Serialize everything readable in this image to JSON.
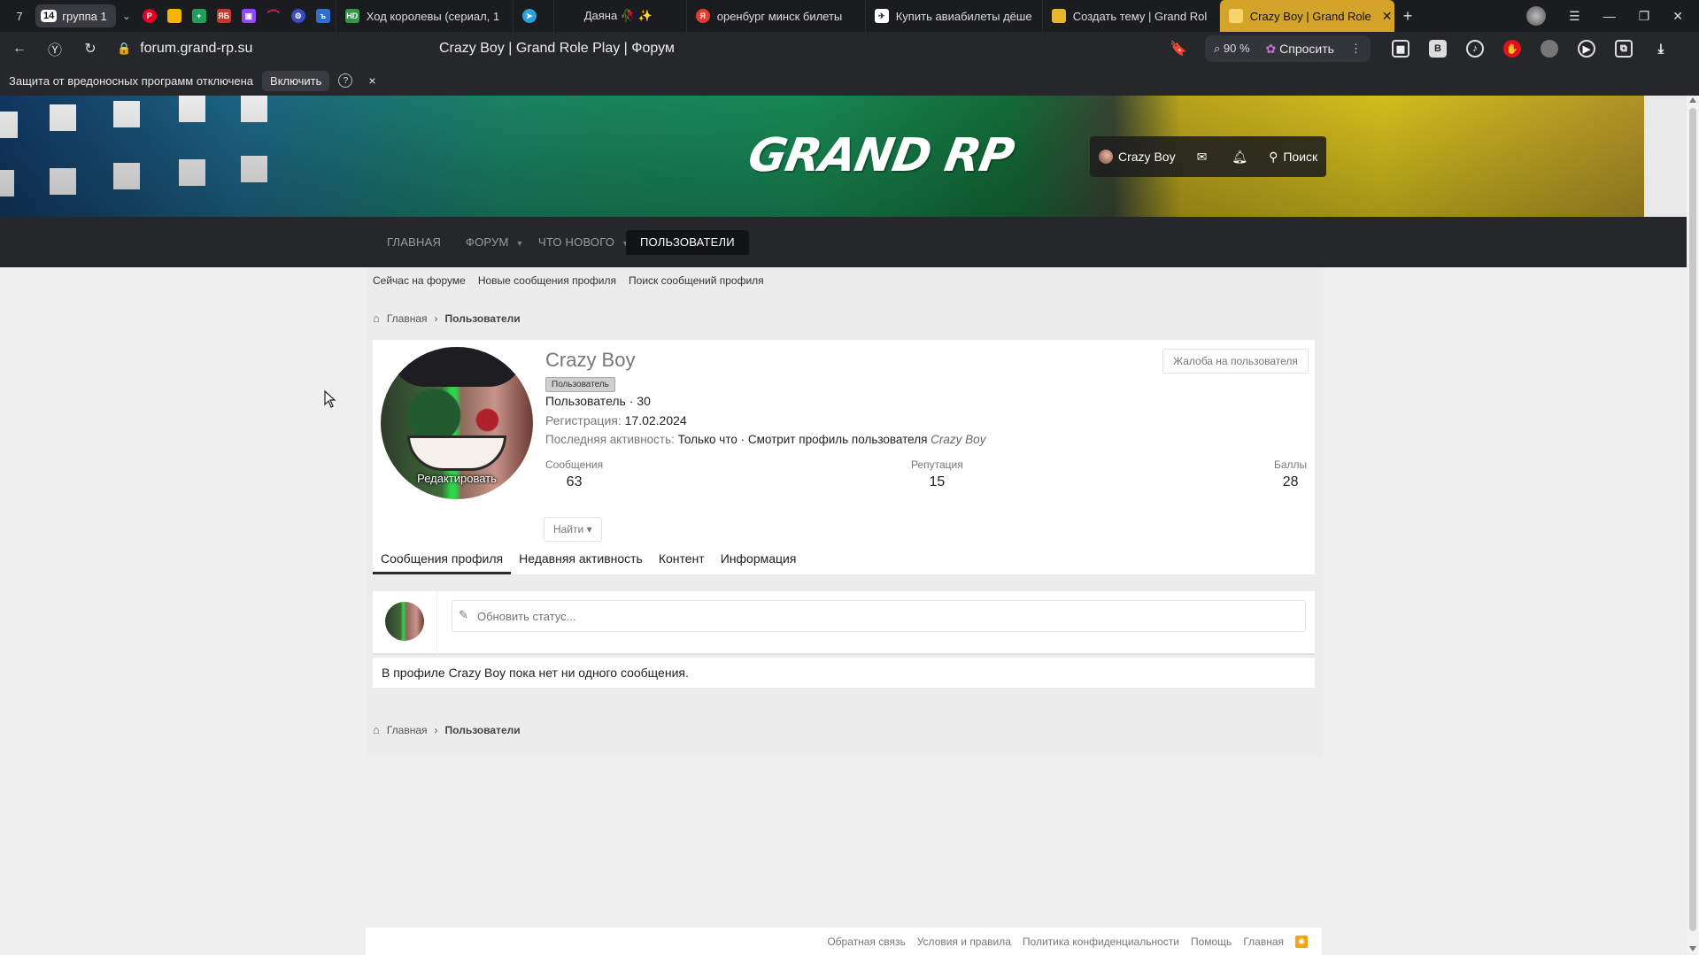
{
  "browser": {
    "tab_count": "7",
    "group": {
      "badge": "14",
      "label": "группа 1"
    },
    "tabs": [
      {
        "title": "Ход королевы (сериал, 1",
        "color": "#2e9a43"
      },
      {
        "title": "",
        "color": "#2aa3dc"
      },
      {
        "title": "Даяна 🥀 ✨",
        "color": "#000000"
      },
      {
        "title": "оренбург минск билеты",
        "color": "#e53a2f"
      },
      {
        "title": "Купить авиабилеты дёше",
        "color": "#333333"
      },
      {
        "title": "Создать тему | Grand Rol",
        "color": "#e8b62b"
      },
      {
        "title": "Crazy Boy | Grand Role",
        "color": "#e8b62b",
        "active": true
      }
    ],
    "url": "forum.grand-rp.su",
    "page_title": "Crazy Boy | Grand Role Play | Форум",
    "zoom": "90 %",
    "ask_label": "Спросить",
    "infobar": {
      "text": "Защита от вредоносных программ отключена",
      "button": "Включить",
      "help": "?",
      "close": "×"
    }
  },
  "site": {
    "logo": "GRAND RP",
    "user_panel": {
      "username": "Crazy Boy",
      "search": "Поиск"
    },
    "nav": [
      {
        "label": "ГЛАВНАЯ"
      },
      {
        "label": "ФОРУМ",
        "dropdown": true
      },
      {
        "label": "ЧТО НОВОГО",
        "dropdown": true
      },
      {
        "label": "ПОЛЬЗОВАТЕЛИ",
        "active": true
      }
    ],
    "subnav": [
      "Сейчас на форуме",
      "Новые сообщения профиля",
      "Поиск сообщений профиля"
    ],
    "breadcrumb": {
      "home": "Главная",
      "current": "Пользователи"
    }
  },
  "profile": {
    "name": "Crazy Boy",
    "badge": "Пользователь",
    "title_line": "Пользователь · 30",
    "registration_label": "Регистрация:",
    "registration_date": "17.02.2024",
    "activity_label": "Последняя активность:",
    "activity_value": "Только что · Смотрит профиль пользователя",
    "activity_target": "Crazy Boy",
    "avatar_edit": "Редактировать",
    "report_button": "Жалоба на пользователя",
    "stats": [
      {
        "label": "Сообщения",
        "value": "63"
      },
      {
        "label": "Репутация",
        "value": "15"
      },
      {
        "label": "Баллы",
        "value": "28"
      }
    ],
    "find_button": "Найти ▾",
    "tabs": [
      {
        "label": "Сообщения профиля",
        "active": true
      },
      {
        "label": "Недавняя активность"
      },
      {
        "label": "Контент"
      },
      {
        "label": "Информация"
      }
    ],
    "status_placeholder": "Обновить статус...",
    "empty_message": "В профиле Crazy Boy пока нет ни одного сообщения."
  },
  "footer": {
    "links": [
      "Обратная связь",
      "Условия и правила",
      "Политика конфиденциальности",
      "Помощь",
      "Главная"
    ]
  },
  "icons": {
    "home": "home-icon",
    "mail": "mail-icon",
    "bell": "bell-icon",
    "search": "search-icon",
    "pencil": "pencil-icon",
    "rss": "rss-icon"
  }
}
